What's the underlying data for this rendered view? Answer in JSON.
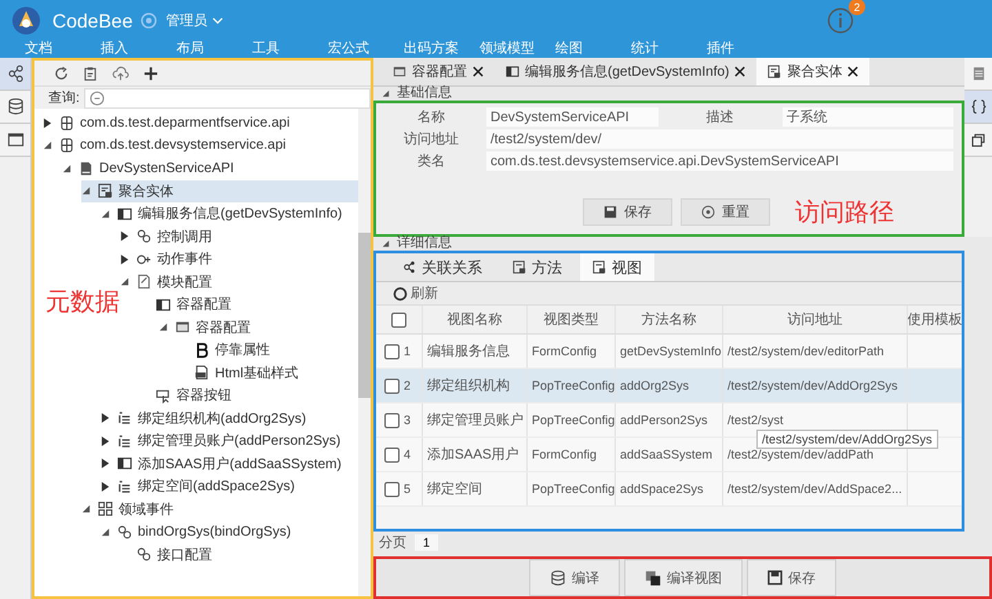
{
  "app": {
    "name": "CodeBee",
    "user": "管理员",
    "notification_count": "2"
  },
  "menu": [
    "文档",
    "插入",
    "布局",
    "工具",
    "宏公式",
    "出码方案",
    "领域模型",
    "绘图",
    "统计",
    "插件"
  ],
  "left_sidebar": [
    {
      "selected": true
    },
    {
      "selected": false
    },
    {
      "selected": false
    }
  ],
  "left_panel": {
    "search_label": "查询:",
    "annotation": "元数据",
    "tree": [
      {
        "label": "com.ds.test.deparmentfservice.api",
        "kind": "package",
        "expanded": false,
        "selected": false
      },
      {
        "label": "com.ds.test.devsystemservice.api",
        "kind": "package",
        "expanded": true,
        "selected": false,
        "children": [
          {
            "label": "DevSystenServiceAPI",
            "kind": "class",
            "expanded": true,
            "selected": false,
            "children": [
              {
                "label": "聚合实体",
                "kind": "entity",
                "expanded": true,
                "selected": true,
                "children": [
                  {
                    "label": "编辑服务信息(getDevSystemInfo)",
                    "kind": "form",
                    "expanded": true,
                    "selected": false,
                    "children": [
                      {
                        "label": "控制调用",
                        "kind": "link",
                        "expanded": false,
                        "selected": false
                      },
                      {
                        "label": "动作事件",
                        "kind": "event",
                        "expanded": false,
                        "selected": false
                      },
                      {
                        "label": "模块配置",
                        "kind": "config",
                        "expanded": true,
                        "selected": false,
                        "children": [
                          {
                            "label": "容器配置",
                            "kind": "window",
                            "selected": false,
                            "children": [
                              {
                                "label": "容器配置",
                                "kind": "container",
                                "expanded": true,
                                "selected": false,
                                "children": [
                                  {
                                    "label": "停靠属性",
                                    "kind": "bold",
                                    "selected": false
                                  },
                                  {
                                    "label": "Html基础样式",
                                    "kind": "style",
                                    "selected": false
                                  }
                                ]
                              }
                            ]
                          },
                          {
                            "label": "容器按钮",
                            "kind": "button",
                            "selected": false
                          }
                        ]
                      }
                    ]
                  },
                  {
                    "label": "绑定组织机构(addOrg2Sys)",
                    "kind": "tree",
                    "expanded": false,
                    "selected": false
                  },
                  {
                    "label": "绑定管理员账户(addPerson2Sys)",
                    "kind": "tree",
                    "expanded": false,
                    "selected": false
                  },
                  {
                    "label": "添加SAAS用户(addSaaSSystem)",
                    "kind": "form",
                    "expanded": false,
                    "selected": false
                  },
                  {
                    "label": "绑定空间(addSpace2Sys)",
                    "kind": "tree",
                    "expanded": false,
                    "selected": false
                  }
                ]
              },
              {
                "label": "领域事件",
                "kind": "grid",
                "expanded": true,
                "selected": false,
                "children": [
                  {
                    "label": "bindOrgSys(bindOrgSys)",
                    "kind": "link",
                    "expanded": true,
                    "selected": false,
                    "children": [
                      {
                        "label": "接口配置",
                        "kind": "link",
                        "selected": false
                      }
                    ]
                  }
                ]
              }
            ]
          }
        ]
      }
    ]
  },
  "tabs": [
    {
      "label": "容器配置",
      "kind": "window",
      "selected": false
    },
    {
      "label": "编辑服务信息(getDevSystemInfo)",
      "kind": "form",
      "selected": false
    },
    {
      "label": "聚合实体",
      "kind": "entity",
      "selected": true
    }
  ],
  "right_sidebar": [
    {
      "selected": false
    },
    {
      "selected": true
    },
    {
      "selected": false
    }
  ],
  "basic_info": {
    "title": "基础信息",
    "expanded": true,
    "annotation": "访问路径",
    "name_label": "名称",
    "name_value": "DevSystemServiceAPI",
    "desc_label": "描述",
    "desc_value": "子系统",
    "path_label": "访问地址",
    "path_value": "/test2/system/dev/",
    "class_label": "类名",
    "class_value": "com.ds.test.devsystemservice.api.DevSystemServiceAPI",
    "save": "保存",
    "reset": "重置"
  },
  "detail": {
    "title": "详细信息",
    "expanded": true,
    "tabs": [
      {
        "label": "关联关系",
        "selected": false
      },
      {
        "label": "方法",
        "selected": false
      },
      {
        "label": "视图",
        "selected": true
      }
    ],
    "refresh": "刷新",
    "select_all_checked": false,
    "columns": [
      "视图名称",
      "视图类型",
      "方法名称",
      "访问地址",
      "使用模板"
    ],
    "rows": [
      {
        "no": "1",
        "checked": false,
        "selected": false,
        "cells": [
          "编辑服务信息",
          "FormConfig",
          "getDevSystemInfo",
          "/test2/system/dev/editorPath"
        ]
      },
      {
        "no": "2",
        "checked": false,
        "selected": true,
        "cells": [
          "绑定组织机构",
          "PopTreeConfig",
          "addOrg2Sys",
          "/test2/system/dev/AddOrg2Sys"
        ]
      },
      {
        "no": "3",
        "checked": false,
        "selected": false,
        "cells": [
          "绑定管理员账户",
          "PopTreeConfig",
          "addPerson2Sys",
          "/test2/syst"
        ]
      },
      {
        "no": "4",
        "checked": false,
        "selected": false,
        "cells": [
          "添加SAAS用户",
          "FormConfig",
          "addSaaSSystem",
          "/test2/system/dev/addPath"
        ]
      },
      {
        "no": "5",
        "checked": false,
        "selected": false,
        "cells": [
          "绑定空间",
          "PopTreeConfig",
          "addSpace2Sys",
          "/test2/system/dev/AddSpace2..."
        ]
      }
    ],
    "tooltip": "/test2/system/dev/AddOrg2Sys",
    "pagination_label": "分页",
    "page": "1"
  },
  "footer_buttons": [
    {
      "label": "编译",
      "kind": "database"
    },
    {
      "label": "编译视图",
      "kind": "windows"
    },
    {
      "label": "保存",
      "kind": "save"
    }
  ]
}
